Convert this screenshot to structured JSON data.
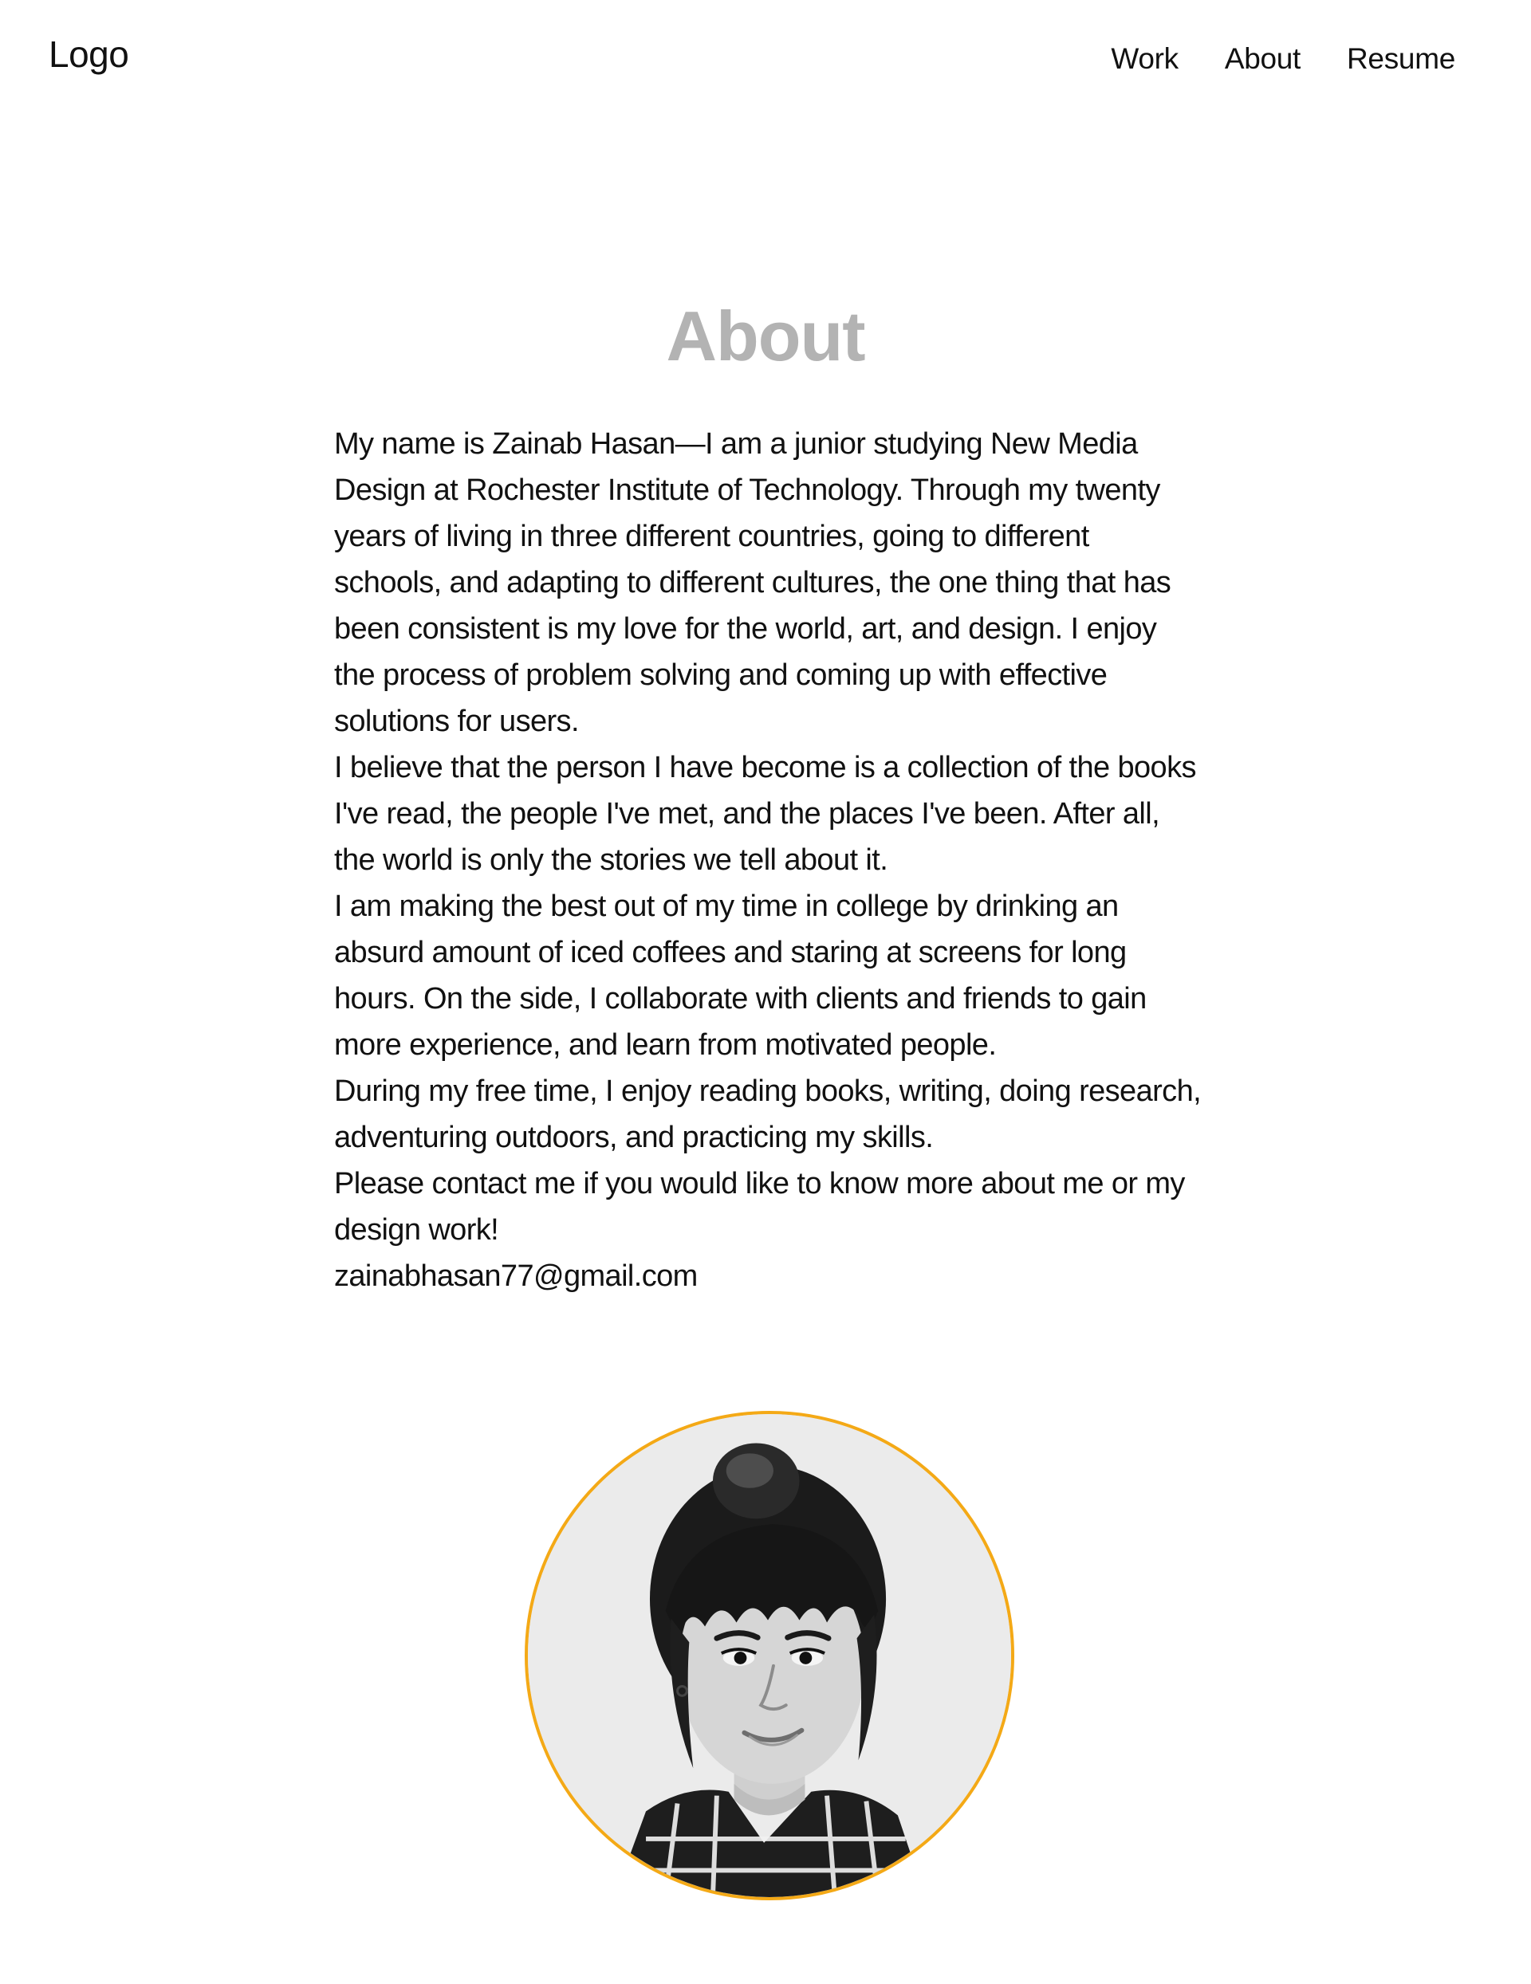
{
  "header": {
    "logo_text": "Logo",
    "nav": [
      {
        "label": "Work"
      },
      {
        "label": "About"
      },
      {
        "label": "Resume"
      }
    ]
  },
  "main": {
    "title": "About",
    "paragraphs": [
      "My name is Zainab Hasan—I am a junior studying New Media Design at Rochester Institute of Technology. Through my twenty years of living in three different countries, going to different schools, and adapting to different cultures, the one thing that has been consistent is my love for the world, art, and design. I enjoy the process of problem solving and coming up with effective solutions for users.",
      "I believe that the person I have become is a collection of the books I've read, the people I've met, and the places I've been. After all, the world is only the stories we tell about it.",
      "I am making the best out of my time in college by drinking an absurd amount of iced coffees and staring at screens for long hours. On the side, I collaborate with clients and friends to gain more experience, and learn from motivated people.",
      "During my free time, I enjoy reading books, writing, doing research, adventuring outdoors, and practicing my skills.",
      "Please contact me if you would like to know more about me or my design work!"
    ],
    "email": "zainabhasan77@gmail.com"
  },
  "portrait": {
    "border_color": "#f4a916",
    "style": "black-and-white"
  }
}
